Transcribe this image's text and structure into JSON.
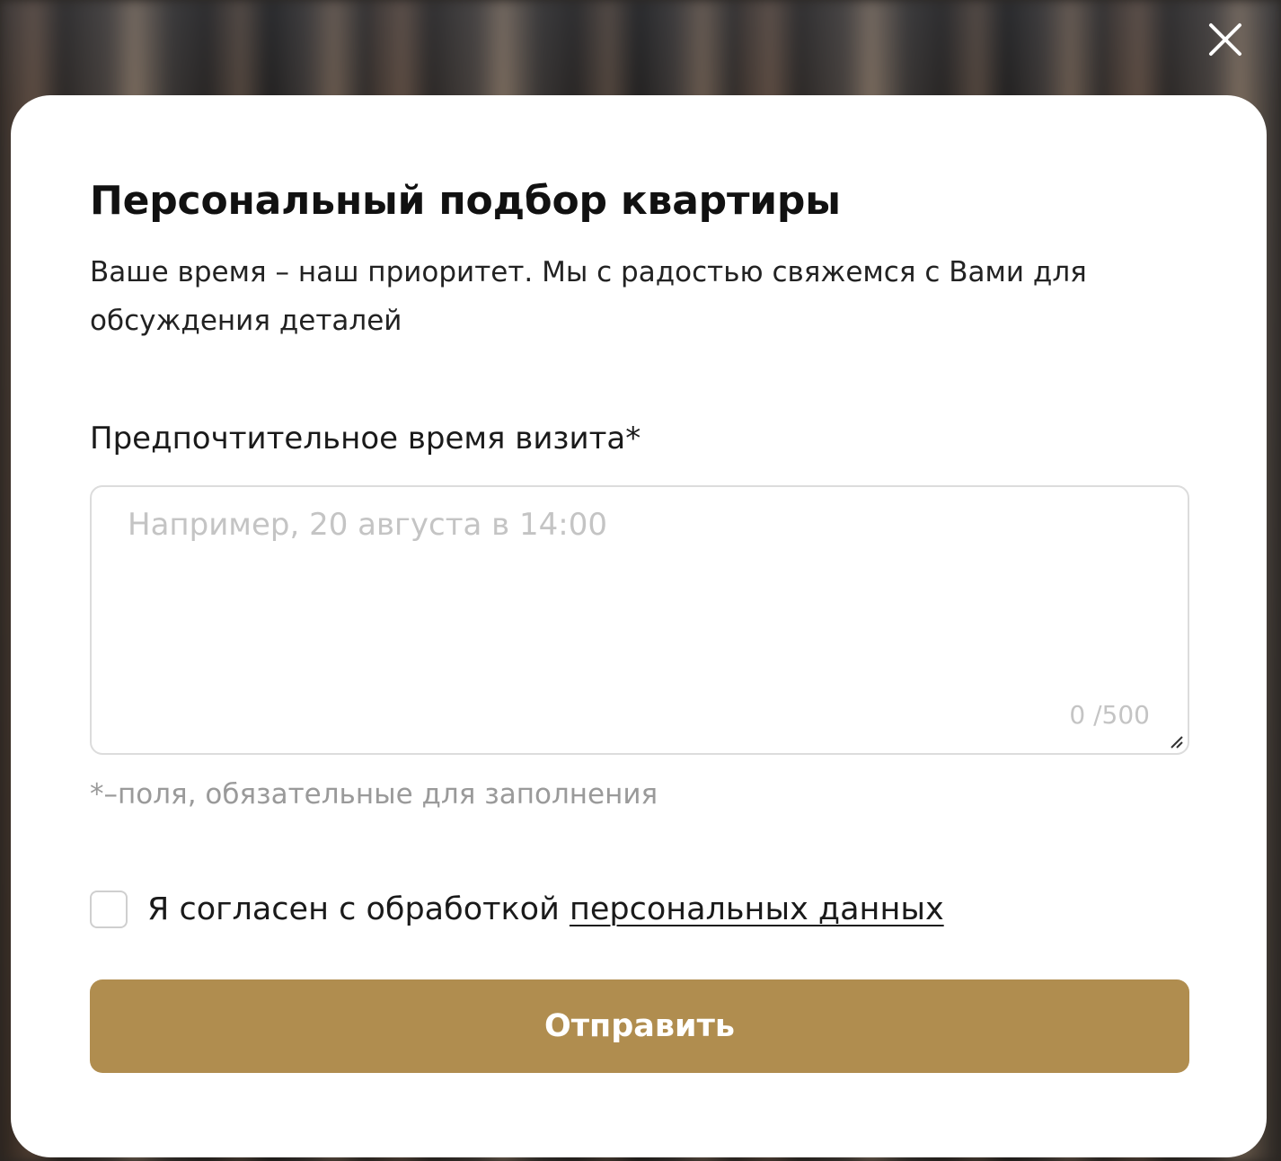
{
  "modal": {
    "title": "Персональный подбор квартиры",
    "subtitle": "Ваше время – наш приоритет. Мы с радостью свяжемся с Вами для обсуждения деталей",
    "close_icon": "close-icon"
  },
  "form": {
    "visit_time": {
      "label": "Предпочтительное время визита*",
      "value": "",
      "placeholder": "Например, 20 августа в 14:00",
      "counter": "0 /500"
    },
    "required_note": "*–поля, обязательные для заполнения",
    "consent": {
      "checked": false,
      "text": "Я согласен с обработкой ",
      "link_text": "персональных данных"
    },
    "submit_label": "Отправить"
  },
  "colors": {
    "accent": "#b08d4f",
    "text": "#1a1a1a",
    "muted": "#9a9a9a",
    "placeholder": "#c4c4c4",
    "border": "#dcdcdc"
  }
}
